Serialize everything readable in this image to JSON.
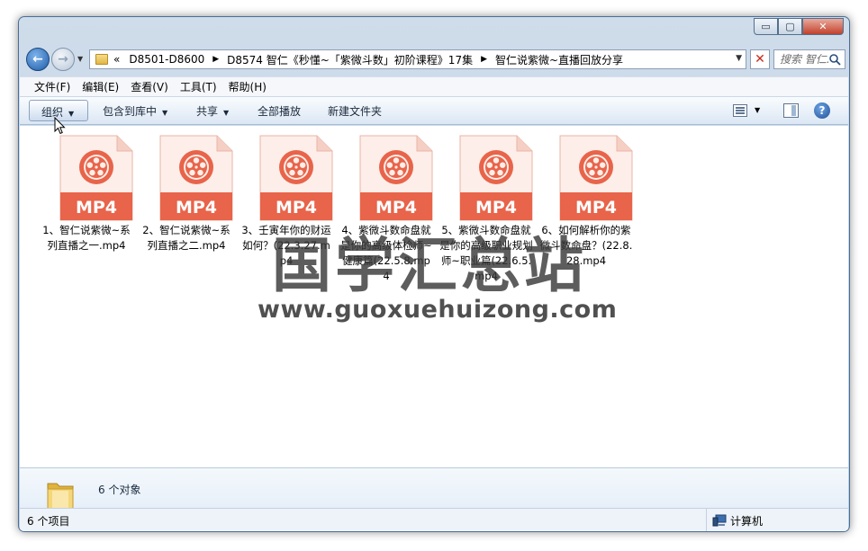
{
  "window": {
    "caption_buttons": {
      "minimize": "▭",
      "maximize": "▢",
      "close": "✕"
    }
  },
  "nav": {
    "back_icon": "back-arrow-icon",
    "forward_icon": "forward-arrow-icon",
    "address": {
      "overflow": "«",
      "crumbs": [
        "D8501-D8600",
        "D8574 智仁《秒懂~「紫微斗数」初阶课程》17集",
        "智仁说紫微~直播回放分享"
      ]
    },
    "search_placeholder": "搜索 智仁..."
  },
  "menubar": {
    "items": [
      "文件(F)",
      "编辑(E)",
      "查看(V)",
      "工具(T)",
      "帮助(H)"
    ]
  },
  "toolbar": {
    "organize": "组织",
    "include_library": "包含到库中",
    "share": "共享",
    "play_all": "全部播放",
    "new_folder": "新建文件夹"
  },
  "files": [
    {
      "name": "1、智仁说紫微~系列直播之一.mp4",
      "badge": "MP4"
    },
    {
      "name": "2、智仁说紫微~系列直播之二.mp4",
      "badge": "MP4"
    },
    {
      "name": "3、壬寅年你的财运如何？(22.3.27.mp4",
      "badge": "MP4"
    },
    {
      "name": "4、紫微斗数命盘就是你的高级体检师~健康篇(22.5.8.mp4",
      "badge": "MP4"
    },
    {
      "name": "5、紫微斗数命盘就是你的高级职业规划师~职业篇(22.6.5.mp4",
      "badge": "MP4"
    },
    {
      "name": "6、如何解析你的紫微斗数命盘？(22.8.28.mp4",
      "badge": "MP4"
    }
  ],
  "watermark": {
    "text": "国学汇总站",
    "url": "www.guoxuehuizong.com"
  },
  "details": {
    "summary": "6 个对象"
  },
  "status": {
    "count": "6 个项目",
    "location": "计算机"
  },
  "colors": {
    "mp4_accent": "#e8644a",
    "window_frame": "#bcd0e6",
    "close_button": "#c2412c"
  }
}
